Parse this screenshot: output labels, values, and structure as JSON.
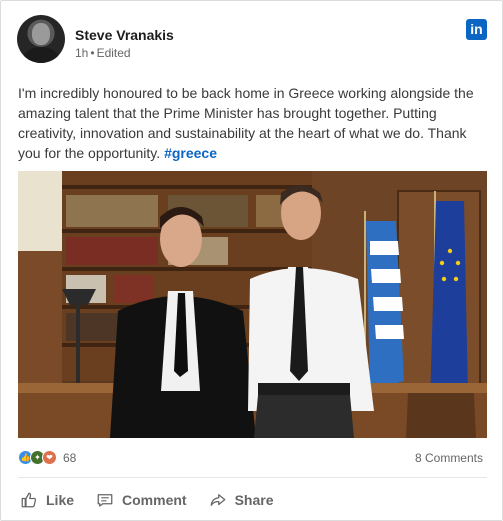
{
  "post": {
    "author_name": "Steve Vranakis",
    "time": "1h",
    "separator": "•",
    "edited": "Edited",
    "body": "I'm incredibly honoured to be back home in Greece working alongside the amazing talent that the Prime Minister has brought together. Putting creativity, innovation and sustainability at the heart of what we do. Thank you for the opportunity.",
    "hashtag": "#greece"
  },
  "brand": {
    "logo_text": "in",
    "color": "#0a66c2"
  },
  "social": {
    "reaction_count": "68",
    "comments": "8 Comments",
    "reactions": [
      "like-icon",
      "celebrate-icon",
      "love-icon"
    ]
  },
  "actions": {
    "like": "Like",
    "comment": "Comment",
    "share": "Share"
  },
  "icons": {
    "like": "thumbs-up-icon",
    "comment": "comment-icon",
    "share": "share-icon"
  }
}
